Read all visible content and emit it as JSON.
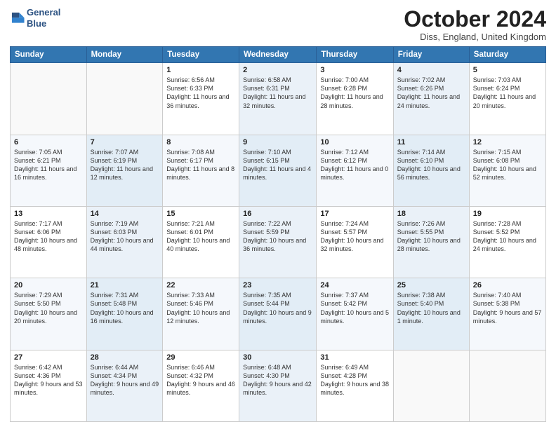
{
  "header": {
    "logo_line1": "General",
    "logo_line2": "Blue",
    "month": "October 2024",
    "location": "Diss, England, United Kingdom"
  },
  "weekdays": [
    "Sunday",
    "Monday",
    "Tuesday",
    "Wednesday",
    "Thursday",
    "Friday",
    "Saturday"
  ],
  "weeks": [
    [
      {
        "day": "",
        "info": ""
      },
      {
        "day": "",
        "info": ""
      },
      {
        "day": "1",
        "info": "Sunrise: 6:56 AM\nSunset: 6:33 PM\nDaylight: 11 hours and 36 minutes."
      },
      {
        "day": "2",
        "info": "Sunrise: 6:58 AM\nSunset: 6:31 PM\nDaylight: 11 hours and 32 minutes."
      },
      {
        "day": "3",
        "info": "Sunrise: 7:00 AM\nSunset: 6:28 PM\nDaylight: 11 hours and 28 minutes."
      },
      {
        "day": "4",
        "info": "Sunrise: 7:02 AM\nSunset: 6:26 PM\nDaylight: 11 hours and 24 minutes."
      },
      {
        "day": "5",
        "info": "Sunrise: 7:03 AM\nSunset: 6:24 PM\nDaylight: 11 hours and 20 minutes."
      }
    ],
    [
      {
        "day": "6",
        "info": "Sunrise: 7:05 AM\nSunset: 6:21 PM\nDaylight: 11 hours and 16 minutes."
      },
      {
        "day": "7",
        "info": "Sunrise: 7:07 AM\nSunset: 6:19 PM\nDaylight: 11 hours and 12 minutes."
      },
      {
        "day": "8",
        "info": "Sunrise: 7:08 AM\nSunset: 6:17 PM\nDaylight: 11 hours and 8 minutes."
      },
      {
        "day": "9",
        "info": "Sunrise: 7:10 AM\nSunset: 6:15 PM\nDaylight: 11 hours and 4 minutes."
      },
      {
        "day": "10",
        "info": "Sunrise: 7:12 AM\nSunset: 6:12 PM\nDaylight: 11 hours and 0 minutes."
      },
      {
        "day": "11",
        "info": "Sunrise: 7:14 AM\nSunset: 6:10 PM\nDaylight: 10 hours and 56 minutes."
      },
      {
        "day": "12",
        "info": "Sunrise: 7:15 AM\nSunset: 6:08 PM\nDaylight: 10 hours and 52 minutes."
      }
    ],
    [
      {
        "day": "13",
        "info": "Sunrise: 7:17 AM\nSunset: 6:06 PM\nDaylight: 10 hours and 48 minutes."
      },
      {
        "day": "14",
        "info": "Sunrise: 7:19 AM\nSunset: 6:03 PM\nDaylight: 10 hours and 44 minutes."
      },
      {
        "day": "15",
        "info": "Sunrise: 7:21 AM\nSunset: 6:01 PM\nDaylight: 10 hours and 40 minutes."
      },
      {
        "day": "16",
        "info": "Sunrise: 7:22 AM\nSunset: 5:59 PM\nDaylight: 10 hours and 36 minutes."
      },
      {
        "day": "17",
        "info": "Sunrise: 7:24 AM\nSunset: 5:57 PM\nDaylight: 10 hours and 32 minutes."
      },
      {
        "day": "18",
        "info": "Sunrise: 7:26 AM\nSunset: 5:55 PM\nDaylight: 10 hours and 28 minutes."
      },
      {
        "day": "19",
        "info": "Sunrise: 7:28 AM\nSunset: 5:52 PM\nDaylight: 10 hours and 24 minutes."
      }
    ],
    [
      {
        "day": "20",
        "info": "Sunrise: 7:29 AM\nSunset: 5:50 PM\nDaylight: 10 hours and 20 minutes."
      },
      {
        "day": "21",
        "info": "Sunrise: 7:31 AM\nSunset: 5:48 PM\nDaylight: 10 hours and 16 minutes."
      },
      {
        "day": "22",
        "info": "Sunrise: 7:33 AM\nSunset: 5:46 PM\nDaylight: 10 hours and 12 minutes."
      },
      {
        "day": "23",
        "info": "Sunrise: 7:35 AM\nSunset: 5:44 PM\nDaylight: 10 hours and 9 minutes."
      },
      {
        "day": "24",
        "info": "Sunrise: 7:37 AM\nSunset: 5:42 PM\nDaylight: 10 hours and 5 minutes."
      },
      {
        "day": "25",
        "info": "Sunrise: 7:38 AM\nSunset: 5:40 PM\nDaylight: 10 hours and 1 minute."
      },
      {
        "day": "26",
        "info": "Sunrise: 7:40 AM\nSunset: 5:38 PM\nDaylight: 9 hours and 57 minutes."
      }
    ],
    [
      {
        "day": "27",
        "info": "Sunrise: 6:42 AM\nSunset: 4:36 PM\nDaylight: 9 hours and 53 minutes."
      },
      {
        "day": "28",
        "info": "Sunrise: 6:44 AM\nSunset: 4:34 PM\nDaylight: 9 hours and 49 minutes."
      },
      {
        "day": "29",
        "info": "Sunrise: 6:46 AM\nSunset: 4:32 PM\nDaylight: 9 hours and 46 minutes."
      },
      {
        "day": "30",
        "info": "Sunrise: 6:48 AM\nSunset: 4:30 PM\nDaylight: 9 hours and 42 minutes."
      },
      {
        "day": "31",
        "info": "Sunrise: 6:49 AM\nSunset: 4:28 PM\nDaylight: 9 hours and 38 minutes."
      },
      {
        "day": "",
        "info": ""
      },
      {
        "day": "",
        "info": ""
      }
    ]
  ]
}
